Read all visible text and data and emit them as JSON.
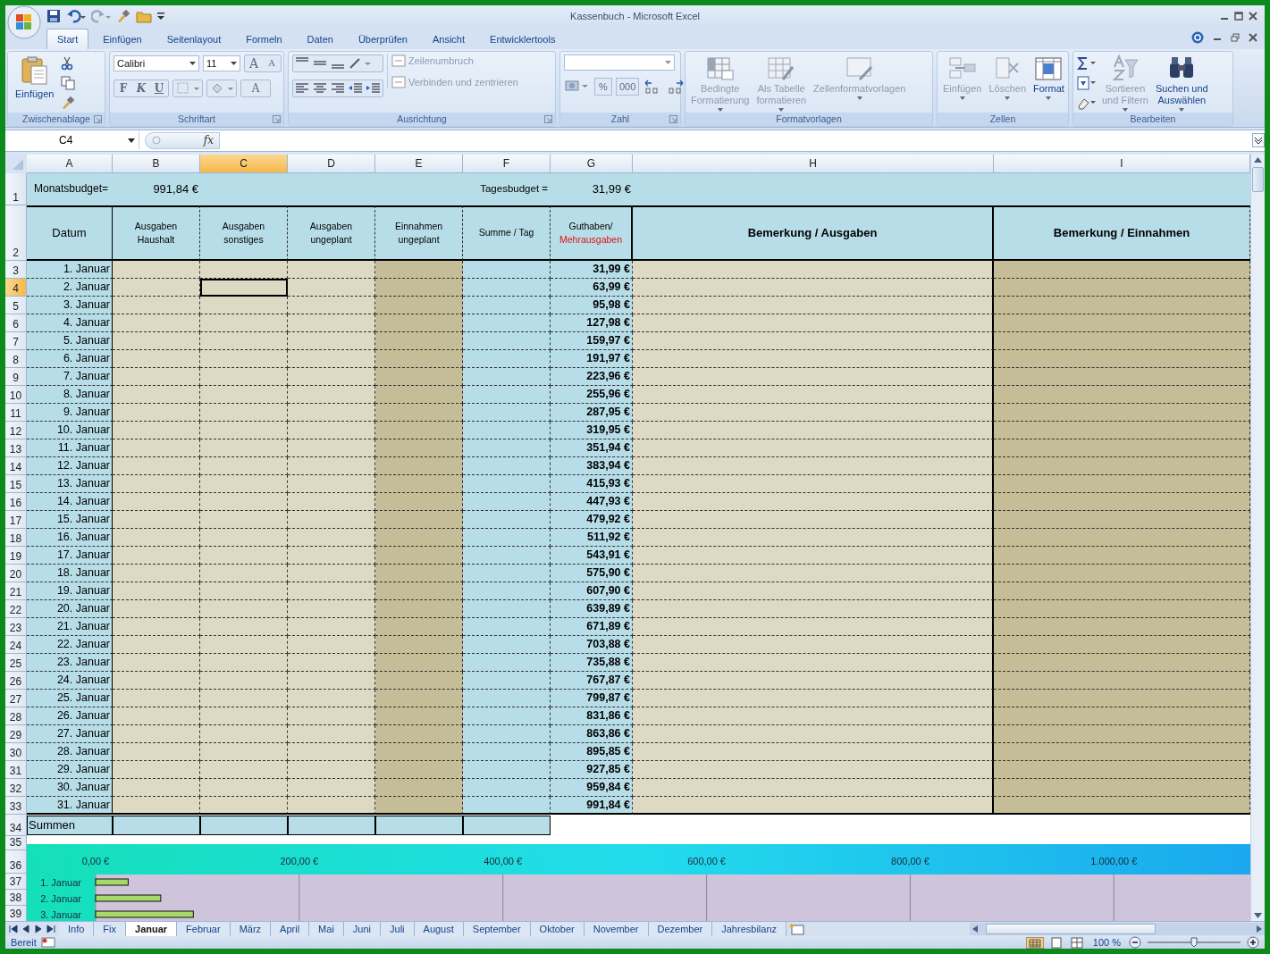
{
  "window": {
    "title": "Kassenbuch - Microsoft Excel"
  },
  "ribbon": {
    "tabs": [
      {
        "label": "Start",
        "selected": true
      },
      {
        "label": "Einfügen",
        "selected": false
      },
      {
        "label": "Seitenlayout",
        "selected": false
      },
      {
        "label": "Formeln",
        "selected": false
      },
      {
        "label": "Daten",
        "selected": false
      },
      {
        "label": "Überprüfen",
        "selected": false
      },
      {
        "label": "Ansicht",
        "selected": false
      },
      {
        "label": "Entwicklertools",
        "selected": false
      }
    ],
    "groups": [
      {
        "kind": "clipboard",
        "label": "Zwischenablage",
        "paste": "Einfügen"
      },
      {
        "kind": "font",
        "label": "Schriftart",
        "font_name": "Calibri",
        "font_size": "11",
        "grow": "A",
        "shrink": "A",
        "bold": "F",
        "italic": "K",
        "underline": "U",
        "font_color": "A"
      },
      {
        "kind": "alignment",
        "label": "Ausrichtung",
        "buttons": [
          {
            "label": "Zeilenumbruch",
            "disabled": true
          },
          {
            "label": "Verbinden und zentrieren",
            "disabled": true
          }
        ]
      },
      {
        "kind": "number",
        "label": "Zahl",
        "percent": "%",
        "thousands": "000"
      },
      {
        "kind": "styles",
        "label": "Formatvorlagen",
        "buttons": [
          {
            "label": "Bedingte\nFormatierung",
            "disabled": true
          },
          {
            "label": "Als Tabelle\nformatieren",
            "disabled": true
          },
          {
            "label": "Zellenformatvorlagen",
            "disabled": true
          }
        ]
      },
      {
        "kind": "cells",
        "label": "Zellen",
        "buttons": [
          {
            "label": "Einfügen",
            "disabled": true
          },
          {
            "label": "Löschen",
            "disabled": true
          },
          {
            "label": "Format",
            "disabled": false
          }
        ]
      },
      {
        "kind": "editing",
        "label": "Bearbeiten",
        "buttons": [
          {
            "label": "Sortieren\nund Filtern",
            "disabled": true
          },
          {
            "label": "Suchen und\nAuswählen",
            "disabled": false
          }
        ]
      }
    ]
  },
  "formula_bar": {
    "name_box": "C4",
    "function_label": "fx"
  },
  "columns": [
    {
      "label": "A",
      "selected": false
    },
    {
      "label": "B",
      "selected": false
    },
    {
      "label": "C",
      "selected": true
    },
    {
      "label": "D",
      "selected": false
    },
    {
      "label": "E",
      "selected": false
    },
    {
      "label": "F",
      "selected": false
    },
    {
      "label": "G",
      "selected": false
    },
    {
      "label": "H",
      "selected": false
    },
    {
      "label": "I",
      "selected": false
    }
  ],
  "budget_row": {
    "number": "1",
    "monthly_label": "Monatsbudget=",
    "monthly_value": "991,84 €",
    "daily_label": "Tagesbudget =",
    "daily_value": "31,99 €"
  },
  "header_row": {
    "number": "2",
    "headers": [
      {
        "text": "Datum",
        "kind": "main"
      },
      {
        "text": "Ausgaben\nHaushalt",
        "kind": "small"
      },
      {
        "text": "Ausgaben\nsonstiges",
        "kind": "small"
      },
      {
        "text": "Ausgaben\nungeplant",
        "kind": "small"
      },
      {
        "text": "Einnahmen\nungeplant",
        "kind": "small"
      },
      {
        "text": "Summe / Tag",
        "kind": "small"
      },
      {
        "text": "Guthaben/",
        "note": "Mehrausgaben",
        "kind": "small"
      },
      {
        "text": "Bemerkung / Ausgaben",
        "kind": "bold"
      },
      {
        "text": "Bemerkung / Einnahmen",
        "kind": "bold"
      }
    ]
  },
  "rows": [
    {
      "number": "3",
      "date": "1. Januar",
      "balance": "31,99 €",
      "selected": false
    },
    {
      "number": "4",
      "date": "2. Januar",
      "balance": "63,99 €",
      "selected": true
    },
    {
      "number": "5",
      "date": "3. Januar",
      "balance": "95,98 €",
      "selected": false
    },
    {
      "number": "6",
      "date": "4. Januar",
      "balance": "127,98 €",
      "selected": false
    },
    {
      "number": "7",
      "date": "5. Januar",
      "balance": "159,97 €",
      "selected": false
    },
    {
      "number": "8",
      "date": "6. Januar",
      "balance": "191,97 €",
      "selected": false
    },
    {
      "number": "9",
      "date": "7. Januar",
      "balance": "223,96 €",
      "selected": false
    },
    {
      "number": "10",
      "date": "8. Januar",
      "balance": "255,96 €",
      "selected": false
    },
    {
      "number": "11",
      "date": "9. Januar",
      "balance": "287,95 €",
      "selected": false
    },
    {
      "number": "12",
      "date": "10. Januar",
      "balance": "319,95 €",
      "selected": false
    },
    {
      "number": "13",
      "date": "11. Januar",
      "balance": "351,94 €",
      "selected": false
    },
    {
      "number": "14",
      "date": "12. Januar",
      "balance": "383,94 €",
      "selected": false
    },
    {
      "number": "15",
      "date": "13. Januar",
      "balance": "415,93 €",
      "selected": false
    },
    {
      "number": "16",
      "date": "14. Januar",
      "balance": "447,93 €",
      "selected": false
    },
    {
      "number": "17",
      "date": "15. Januar",
      "balance": "479,92 €",
      "selected": false
    },
    {
      "number": "18",
      "date": "16. Januar",
      "balance": "511,92 €",
      "selected": false
    },
    {
      "number": "19",
      "date": "17. Januar",
      "balance": "543,91 €",
      "selected": false
    },
    {
      "number": "20",
      "date": "18. Januar",
      "balance": "575,90 €",
      "selected": false
    },
    {
      "number": "21",
      "date": "19. Januar",
      "balance": "607,90 €",
      "selected": false
    },
    {
      "number": "22",
      "date": "20. Januar",
      "balance": "639,89 €",
      "selected": false
    },
    {
      "number": "23",
      "date": "21. Januar",
      "balance": "671,89 €",
      "selected": false
    },
    {
      "number": "24",
      "date": "22. Januar",
      "balance": "703,88 €",
      "selected": false
    },
    {
      "number": "25",
      "date": "23. Januar",
      "balance": "735,88 €",
      "selected": false
    },
    {
      "number": "26",
      "date": "24. Januar",
      "balance": "767,87 €",
      "selected": false
    },
    {
      "number": "27",
      "date": "25. Januar",
      "balance": "799,87 €",
      "selected": false
    },
    {
      "number": "28",
      "date": "26. Januar",
      "balance": "831,86 €",
      "selected": false
    },
    {
      "number": "29",
      "date": "27. Januar",
      "balance": "863,86 €",
      "selected": false
    },
    {
      "number": "30",
      "date": "28. Januar",
      "balance": "895,85 €",
      "selected": false
    },
    {
      "number": "31",
      "date": "29. Januar",
      "balance": "927,85 €",
      "selected": false
    },
    {
      "number": "32",
      "date": "30. Januar",
      "balance": "959,84 €",
      "selected": false
    },
    {
      "number": "33",
      "date": "31. Januar",
      "balance": "991,84 €",
      "selected": false
    }
  ],
  "sum_row": {
    "number": "34",
    "label": "Summen"
  },
  "chart_rows": [
    "35",
    "36",
    "37",
    "38",
    "39"
  ],
  "chart_data": {
    "type": "bar",
    "orientation": "horizontal",
    "categories": [
      "1. Januar",
      "2. Januar",
      "3. Januar"
    ],
    "values": [
      32,
      64,
      96
    ],
    "xlim": [
      0,
      1134
    ],
    "grid": true,
    "xticks": [
      {
        "value": 0,
        "label": "0,00 €"
      },
      {
        "value": 200,
        "label": "200,00 €"
      },
      {
        "value": 400,
        "label": "400,00 €"
      },
      {
        "value": 600,
        "label": "600,00 €"
      },
      {
        "value": 800,
        "label": "800,00 €"
      },
      {
        "value": 1000,
        "label": "1.000,00 €"
      }
    ]
  },
  "sheet_tabs": [
    {
      "label": "Info",
      "selected": false
    },
    {
      "label": "Fix",
      "selected": false
    },
    {
      "label": "Januar",
      "selected": true
    },
    {
      "label": "Februar",
      "selected": false
    },
    {
      "label": "März",
      "selected": false
    },
    {
      "label": "April",
      "selected": false
    },
    {
      "label": "Mai",
      "selected": false
    },
    {
      "label": "Juni",
      "selected": false
    },
    {
      "label": "Juli",
      "selected": false
    },
    {
      "label": "August",
      "selected": false
    },
    {
      "label": "September",
      "selected": false
    },
    {
      "label": "Oktober",
      "selected": false
    },
    {
      "label": "November",
      "selected": false
    },
    {
      "label": "Dezember",
      "selected": false
    },
    {
      "label": "Jahresbilanz",
      "selected": false
    }
  ],
  "status_bar": {
    "status": "Bereit",
    "zoom": "100 %",
    "zoom_slider": {
      "level": 0.5
    }
  }
}
